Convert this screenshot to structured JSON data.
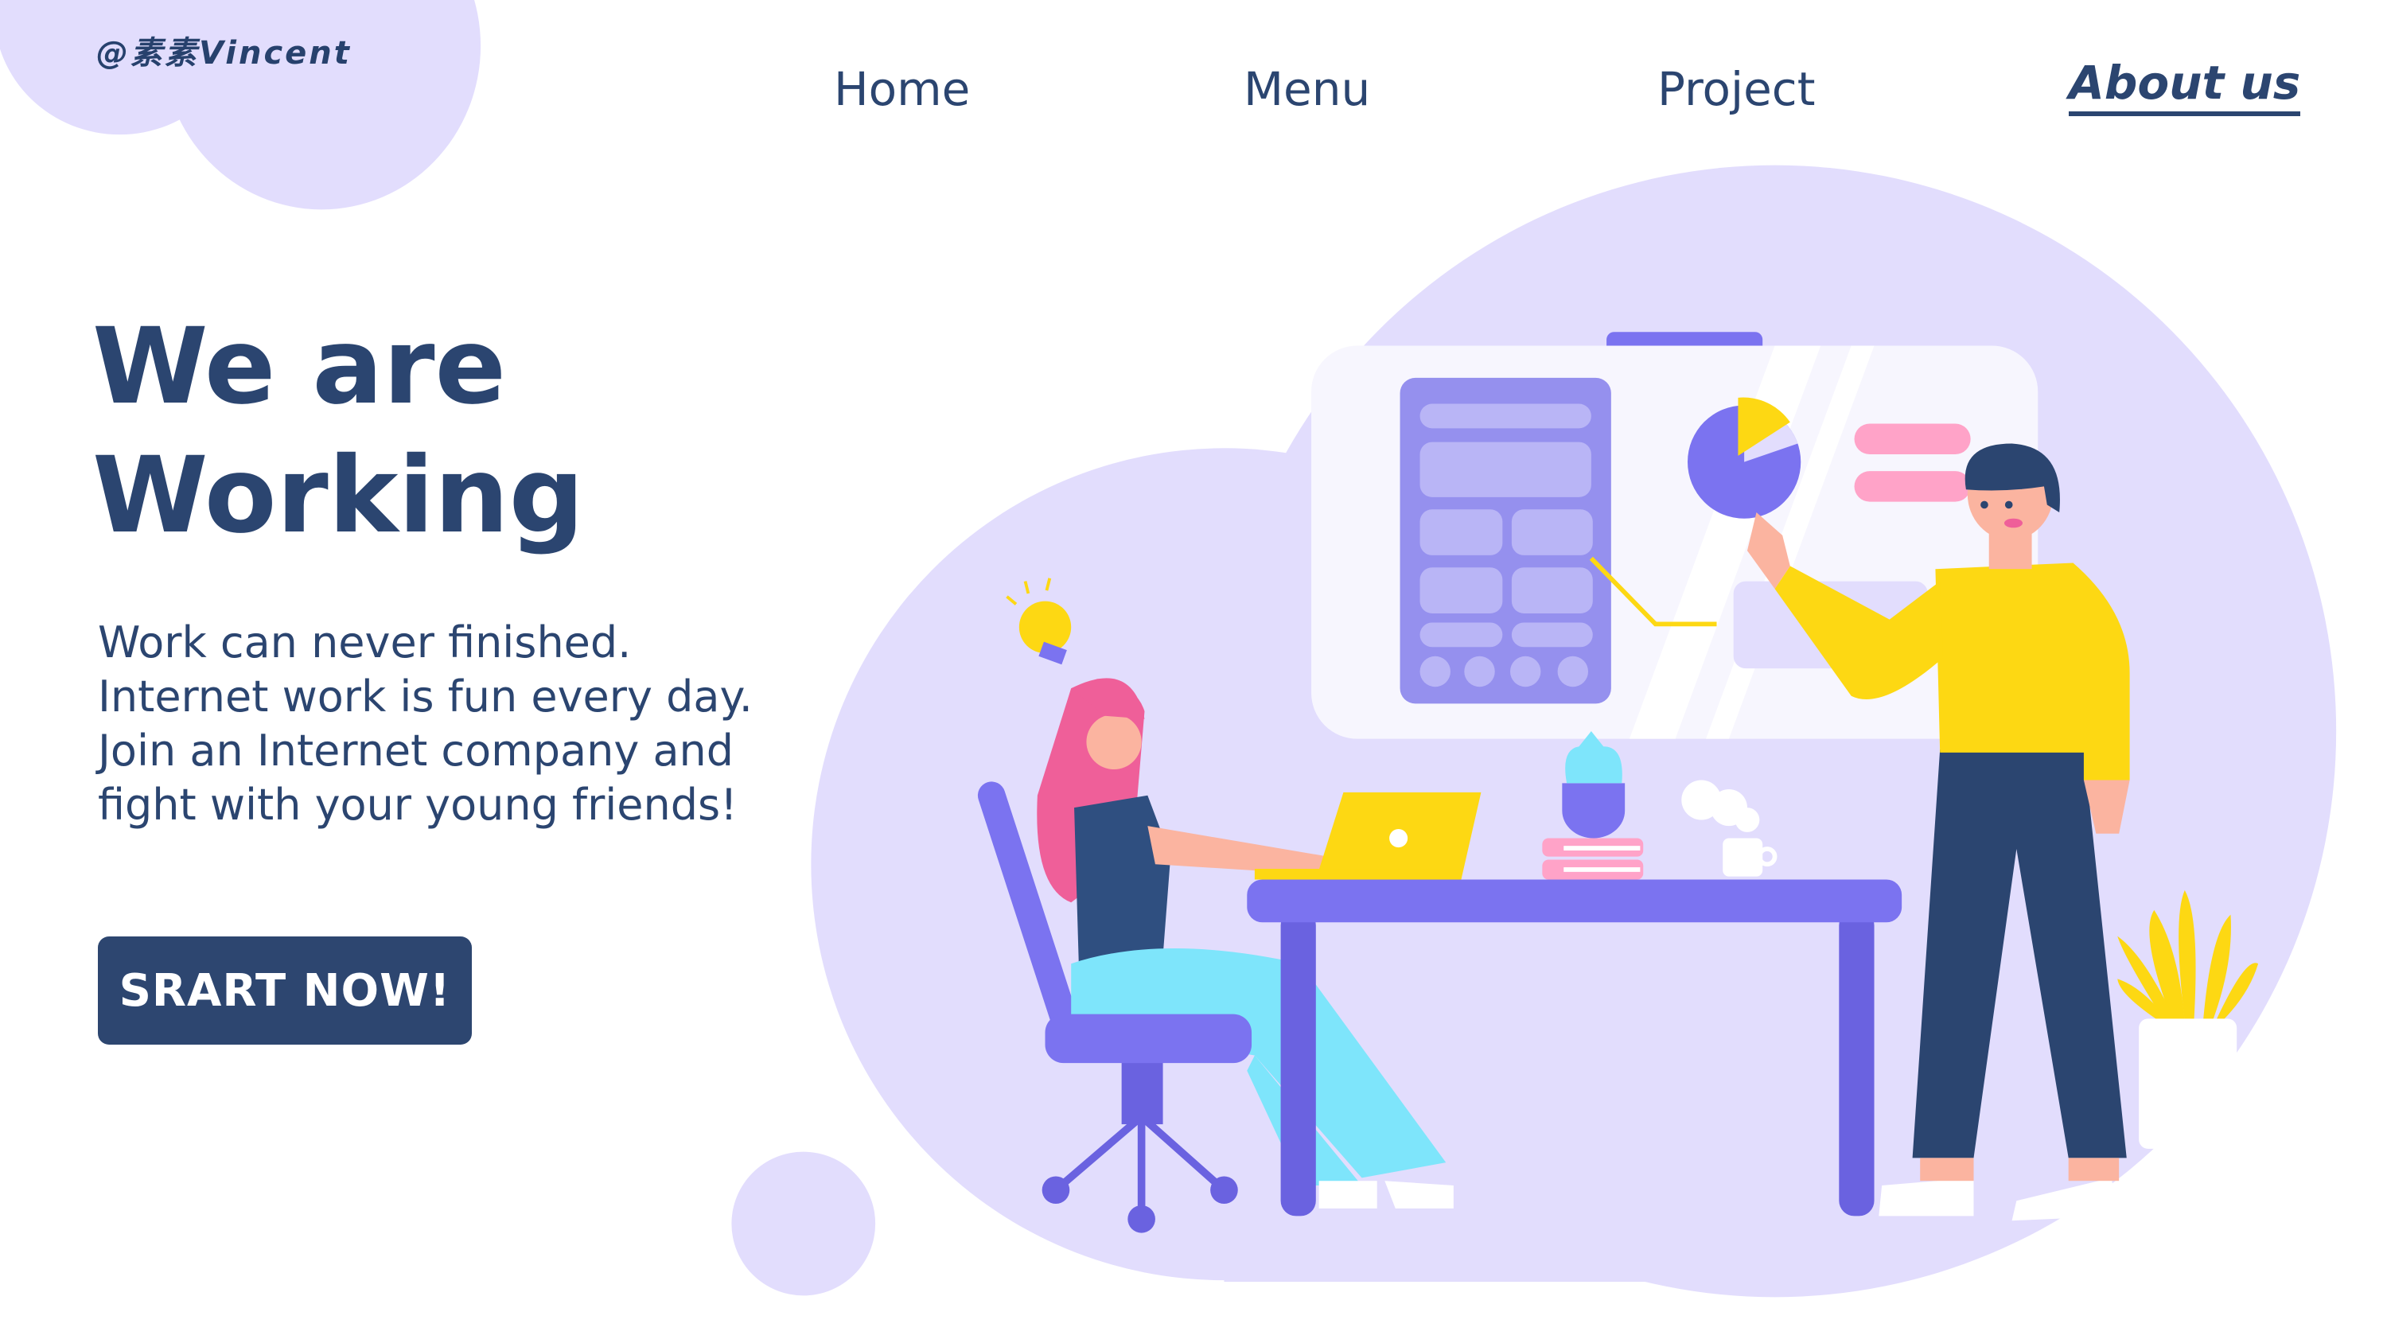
{
  "brand": {
    "logo_text": "@素素Vincent"
  },
  "nav": {
    "items": [
      {
        "label": "Home"
      },
      {
        "label": "Menu"
      },
      {
        "label": "Project"
      },
      {
        "label": "About us",
        "active": true
      }
    ]
  },
  "hero": {
    "title_line1": "We are",
    "title_line2": "Working",
    "paragraph": [
      "Work can never finished.",
      "Internet work is fun every day.",
      "Join an Internet company and",
      "fight with your young friends!"
    ],
    "cta_label": "SRART NOW!"
  },
  "colors": {
    "navy": "#2b4570",
    "blob": "#e2ddfd",
    "purple": "#7b73f0",
    "yellow": "#fdd813",
    "pink": "#ef5f99",
    "cyan": "#7ee5fb"
  }
}
